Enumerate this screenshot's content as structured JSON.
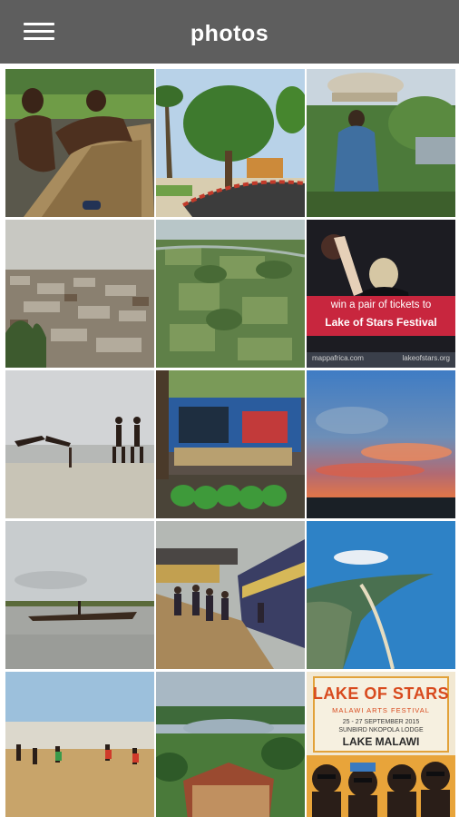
{
  "header": {
    "title": "photos",
    "menu_icon": "hamburger-menu-icon",
    "background": "#5e5e5e"
  },
  "photos": [
    {
      "description": "Two boys in a wooden canoe"
    },
    {
      "description": "Tree-lined road on a hill"
    },
    {
      "description": "Woman carrying bundles on her head"
    },
    {
      "description": "Aerial view of a town with tin roofs"
    },
    {
      "description": "Aerial view of green farmland"
    },
    {
      "description": "Lake of Stars festival ticket giveaway",
      "line1": "win a pair of tickets to",
      "line2": "Lake of Stars Festival",
      "footer_left": "mappafrica.com",
      "footer_right": "lakeofstars.org"
    },
    {
      "description": "Boys playing on a beach"
    },
    {
      "description": "Green vegetables on a market stall"
    },
    {
      "description": "Sunset sky over the horizon"
    },
    {
      "description": "Dugout canoe on a calm lake"
    },
    {
      "description": "Train at a railway station platform"
    },
    {
      "description": "Aerial view of a coastline"
    },
    {
      "description": "Football game on a sandy field"
    },
    {
      "description": "Lake view over a red-roofed building"
    },
    {
      "description": "Lake of Stars festival poster",
      "title": "LAKE OF STARS",
      "subtitle": "MALAWI ARTS FESTIVAL",
      "dates": "25 - 27 SEPTEMBER 2015",
      "venue": "SUNBIRD NKOPOLA LODGE",
      "location": "LAKE MALAWI"
    }
  ]
}
